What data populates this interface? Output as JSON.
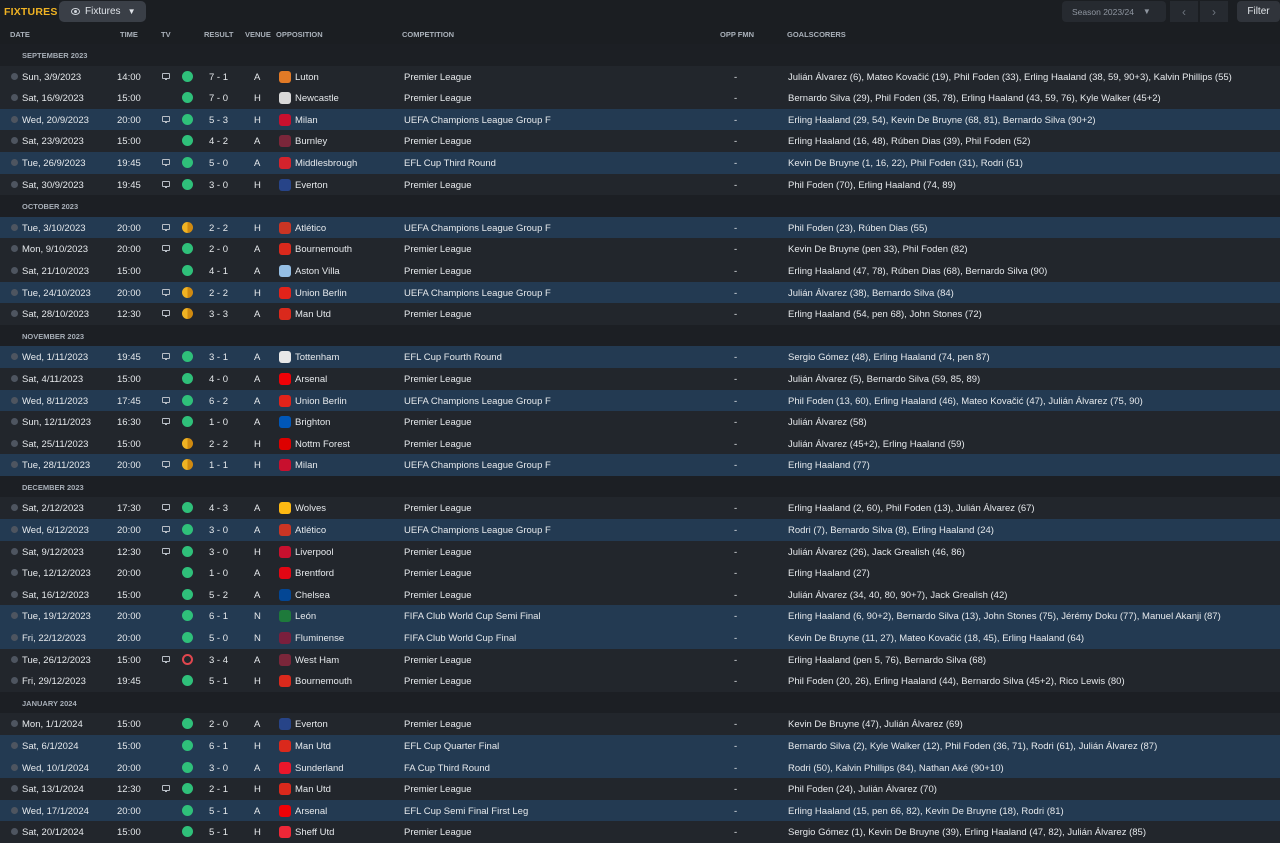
{
  "header": {
    "title": "FIXTURES",
    "view_dropdown": "Fixtures",
    "season": "Season 2023/24",
    "filter": "Filter",
    "prev_icon": "chevron-left-icon",
    "next_icon": "chevron-right-icon"
  },
  "columns": {
    "date": "DATE",
    "time": "TIME",
    "tv": "TV",
    "result": "RESULT",
    "venue": "VENUE",
    "opposition": "OPPOSITION",
    "competition": "COMPETITION",
    "opp_fmn": "OPP FMN",
    "goalscorers": "GOALSCORERS"
  },
  "colors": {
    "win": "#2fc07a",
    "draw": "#f0b323",
    "loss": "#e0464e",
    "accent": "#f0b323",
    "highlight_row": "#233a52"
  },
  "fixtures": [
    {
      "type": "month",
      "label": "SEPTEMBER 2023"
    },
    {
      "date": "Sun, 3/9/2023",
      "time": "14:00",
      "tv": true,
      "outcome": "win",
      "result": "7 - 1",
      "venue": "A",
      "opposition": "Luton",
      "competition": "Premier League",
      "opp_fmn": "-",
      "scorers": "Julián Álvarez (6), Mateo Kovačić (19), Phil Foden (33), Erling Haaland (38, 59, 90+3), Kalvin Phillips (55)",
      "hl": false,
      "crest": "#e27a26"
    },
    {
      "date": "Sat, 16/9/2023",
      "time": "15:00",
      "tv": false,
      "outcome": "win",
      "result": "7 - 0",
      "venue": "H",
      "opposition": "Newcastle",
      "competition": "Premier League",
      "opp_fmn": "-",
      "scorers": "Bernardo Silva (29), Phil Foden (35, 78), Erling Haaland (43, 59, 76), Kyle Walker (45+2)",
      "hl": false,
      "crest": "#d9d9d9"
    },
    {
      "date": "Wed, 20/9/2023",
      "time": "20:00",
      "tv": true,
      "outcome": "win",
      "result": "5 - 3",
      "venue": "H",
      "opposition": "Milan",
      "competition": "UEFA Champions League Group F",
      "opp_fmn": "-",
      "scorers": "Erling Haaland (29, 54), Kevin De Bruyne (68, 81), Bernardo Silva (90+2)",
      "hl": true,
      "crest": "#c8102e"
    },
    {
      "date": "Sat, 23/9/2023",
      "time": "15:00",
      "tv": false,
      "outcome": "win",
      "result": "4 - 2",
      "venue": "A",
      "opposition": "Burnley",
      "competition": "Premier League",
      "opp_fmn": "-",
      "scorers": "Erling Haaland (16, 48), Rúben Dias (39), Phil Foden (52)",
      "hl": false,
      "crest": "#7a263a"
    },
    {
      "date": "Tue, 26/9/2023",
      "time": "19:45",
      "tv": true,
      "outcome": "win",
      "result": "5 - 0",
      "venue": "A",
      "opposition": "Middlesbrough",
      "competition": "EFL Cup Third Round",
      "opp_fmn": "-",
      "scorers": "Kevin De Bruyne (1, 16, 22), Phil Foden (31), Rodri (51)",
      "hl": true,
      "crest": "#d4232c"
    },
    {
      "date": "Sat, 30/9/2023",
      "time": "19:45",
      "tv": true,
      "outcome": "win",
      "result": "3 - 0",
      "venue": "H",
      "opposition": "Everton",
      "competition": "Premier League",
      "opp_fmn": "-",
      "scorers": "Phil Foden (70), Erling Haaland (74, 89)",
      "hl": false,
      "crest": "#274488"
    },
    {
      "type": "month",
      "label": "OCTOBER 2023"
    },
    {
      "date": "Tue, 3/10/2023",
      "time": "20:00",
      "tv": true,
      "outcome": "draw",
      "result": "2 - 2",
      "venue": "H",
      "opposition": "Atlético",
      "competition": "UEFA Champions League Group F",
      "opp_fmn": "-",
      "scorers": "Phil Foden (23), Rúben Dias (55)",
      "hl": true,
      "crest": "#cb3524"
    },
    {
      "date": "Mon, 9/10/2023",
      "time": "20:00",
      "tv": true,
      "outcome": "win",
      "result": "2 - 0",
      "venue": "A",
      "opposition": "Bournemouth",
      "competition": "Premier League",
      "opp_fmn": "-",
      "scorers": "Kevin De Bruyne (pen 33), Phil Foden (82)",
      "hl": false,
      "crest": "#da291c"
    },
    {
      "date": "Sat, 21/10/2023",
      "time": "15:00",
      "tv": false,
      "outcome": "win",
      "result": "4 - 1",
      "venue": "A",
      "opposition": "Aston Villa",
      "competition": "Premier League",
      "opp_fmn": "-",
      "scorers": "Erling Haaland (47, 78), Rúben Dias (68), Bernardo Silva (90)",
      "hl": false,
      "crest": "#95bfe5"
    },
    {
      "date": "Tue, 24/10/2023",
      "time": "20:00",
      "tv": true,
      "outcome": "draw",
      "result": "2 - 2",
      "venue": "H",
      "opposition": "Union Berlin",
      "competition": "UEFA Champions League Group F",
      "opp_fmn": "-",
      "scorers": "Julián Álvarez (38), Bernardo Silva (84)",
      "hl": true,
      "crest": "#e2231a"
    },
    {
      "date": "Sat, 28/10/2023",
      "time": "12:30",
      "tv": true,
      "outcome": "draw",
      "result": "3 - 3",
      "venue": "A",
      "opposition": "Man Utd",
      "competition": "Premier League",
      "opp_fmn": "-",
      "scorers": "Erling Haaland (54, pen 68), John Stones (72)",
      "hl": false,
      "crest": "#da291c"
    },
    {
      "type": "month",
      "label": "NOVEMBER 2023"
    },
    {
      "date": "Wed, 1/11/2023",
      "time": "19:45",
      "tv": true,
      "outcome": "win",
      "result": "3 - 1",
      "venue": "A",
      "opposition": "Tottenham",
      "competition": "EFL Cup Fourth Round",
      "opp_fmn": "-",
      "scorers": "Sergio Gómez (48), Erling Haaland (74, pen 87)",
      "hl": true,
      "crest": "#e8e8e8"
    },
    {
      "date": "Sat, 4/11/2023",
      "time": "15:00",
      "tv": false,
      "outcome": "win",
      "result": "4 - 0",
      "venue": "A",
      "opposition": "Arsenal",
      "competition": "Premier League",
      "opp_fmn": "-",
      "scorers": "Julián Álvarez (5), Bernardo Silva (59, 85, 89)",
      "hl": false,
      "crest": "#ef0107"
    },
    {
      "date": "Wed, 8/11/2023",
      "time": "17:45",
      "tv": true,
      "outcome": "win",
      "result": "6 - 2",
      "venue": "A",
      "opposition": "Union Berlin",
      "competition": "UEFA Champions League Group F",
      "opp_fmn": "-",
      "scorers": "Phil Foden (13, 60), Erling Haaland (46), Mateo Kovačić (47), Julián Álvarez (75, 90)",
      "hl": true,
      "crest": "#e2231a"
    },
    {
      "date": "Sun, 12/11/2023",
      "time": "16:30",
      "tv": true,
      "outcome": "win",
      "result": "1 - 0",
      "venue": "A",
      "opposition": "Brighton",
      "competition": "Premier League",
      "opp_fmn": "-",
      "scorers": "Julián Álvarez (58)",
      "hl": false,
      "crest": "#0057b8"
    },
    {
      "date": "Sat, 25/11/2023",
      "time": "15:00",
      "tv": false,
      "outcome": "draw",
      "result": "2 - 2",
      "venue": "H",
      "opposition": "Nottm Forest",
      "competition": "Premier League",
      "opp_fmn": "-",
      "scorers": "Julián Álvarez (45+2), Erling Haaland (59)",
      "hl": false,
      "crest": "#dd0000"
    },
    {
      "date": "Tue, 28/11/2023",
      "time": "20:00",
      "tv": true,
      "outcome": "draw",
      "result": "1 - 1",
      "venue": "H",
      "opposition": "Milan",
      "competition": "UEFA Champions League Group F",
      "opp_fmn": "-",
      "scorers": "Erling Haaland (77)",
      "hl": true,
      "crest": "#c8102e"
    },
    {
      "type": "month",
      "label": "DECEMBER 2023"
    },
    {
      "date": "Sat, 2/12/2023",
      "time": "17:30",
      "tv": true,
      "outcome": "win",
      "result": "4 - 3",
      "venue": "A",
      "opposition": "Wolves",
      "competition": "Premier League",
      "opp_fmn": "-",
      "scorers": "Erling Haaland (2, 60), Phil Foden (13), Julián Álvarez (67)",
      "hl": false,
      "crest": "#fdb913"
    },
    {
      "date": "Wed, 6/12/2023",
      "time": "20:00",
      "tv": true,
      "outcome": "win",
      "result": "3 - 0",
      "venue": "A",
      "opposition": "Atlético",
      "competition": "UEFA Champions League Group F",
      "opp_fmn": "-",
      "scorers": "Rodri (7), Bernardo Silva (8), Erling Haaland (24)",
      "hl": true,
      "crest": "#cb3524"
    },
    {
      "date": "Sat, 9/12/2023",
      "time": "12:30",
      "tv": true,
      "outcome": "win",
      "result": "3 - 0",
      "venue": "H",
      "opposition": "Liverpool",
      "competition": "Premier League",
      "opp_fmn": "-",
      "scorers": "Julián Álvarez (26), Jack Grealish (46, 86)",
      "hl": false,
      "crest": "#c8102e"
    },
    {
      "date": "Tue, 12/12/2023",
      "time": "20:00",
      "tv": false,
      "outcome": "win",
      "result": "1 - 0",
      "venue": "A",
      "opposition": "Brentford",
      "competition": "Premier League",
      "opp_fmn": "-",
      "scorers": "Erling Haaland (27)",
      "hl": false,
      "crest": "#e30613"
    },
    {
      "date": "Sat, 16/12/2023",
      "time": "15:00",
      "tv": false,
      "outcome": "win",
      "result": "5 - 2",
      "venue": "A",
      "opposition": "Chelsea",
      "competition": "Premier League",
      "opp_fmn": "-",
      "scorers": "Julián Álvarez (34, 40, 80, 90+7), Jack Grealish (42)",
      "hl": false,
      "crest": "#034694"
    },
    {
      "date": "Tue, 19/12/2023",
      "time": "20:00",
      "tv": false,
      "outcome": "win",
      "result": "6 - 1",
      "venue": "N",
      "opposition": "León",
      "competition": "FIFA Club World Cup Semi Final",
      "opp_fmn": "-",
      "scorers": "Erling Haaland (6, 90+2), Bernardo Silva (13), John Stones (75), Jérémy Doku (77), Manuel Akanji (87)",
      "hl": true,
      "crest": "#1e7a3b"
    },
    {
      "date": "Fri, 22/12/2023",
      "time": "20:00",
      "tv": false,
      "outcome": "win",
      "result": "5 - 0",
      "venue": "N",
      "opposition": "Fluminense",
      "competition": "FIFA Club World Cup Final",
      "opp_fmn": "-",
      "scorers": "Kevin De Bruyne (11, 27), Mateo Kovačić (18, 45), Erling Haaland (64)",
      "hl": true,
      "crest": "#7a1f3d"
    },
    {
      "date": "Tue, 26/12/2023",
      "time": "15:00",
      "tv": true,
      "outcome": "loss",
      "result": "3 - 4",
      "venue": "A",
      "opposition": "West Ham",
      "competition": "Premier League",
      "opp_fmn": "-",
      "scorers": "Erling Haaland (pen 5, 76), Bernardo Silva (68)",
      "hl": false,
      "crest": "#7a263a"
    },
    {
      "date": "Fri, 29/12/2023",
      "time": "19:45",
      "tv": false,
      "outcome": "win",
      "result": "5 - 1",
      "venue": "H",
      "opposition": "Bournemouth",
      "competition": "Premier League",
      "opp_fmn": "-",
      "scorers": "Phil Foden (20, 26), Erling Haaland (44), Bernardo Silva (45+2), Rico Lewis (80)",
      "hl": false,
      "crest": "#da291c"
    },
    {
      "type": "month",
      "label": "JANUARY 2024"
    },
    {
      "date": "Mon, 1/1/2024",
      "time": "15:00",
      "tv": false,
      "outcome": "win",
      "result": "2 - 0",
      "venue": "A",
      "opposition": "Everton",
      "competition": "Premier League",
      "opp_fmn": "-",
      "scorers": "Kevin De Bruyne (47), Julián Álvarez (69)",
      "hl": false,
      "crest": "#274488"
    },
    {
      "date": "Sat, 6/1/2024",
      "time": "15:00",
      "tv": false,
      "outcome": "win",
      "result": "6 - 1",
      "venue": "H",
      "opposition": "Man Utd",
      "competition": "EFL Cup Quarter Final",
      "opp_fmn": "-",
      "scorers": "Bernardo Silva (2), Kyle Walker (12), Phil Foden (36, 71), Rodri (61), Julián Álvarez (87)",
      "hl": true,
      "crest": "#da291c"
    },
    {
      "date": "Wed, 10/1/2024",
      "time": "20:00",
      "tv": false,
      "outcome": "win",
      "result": "3 - 0",
      "venue": "A",
      "opposition": "Sunderland",
      "competition": "FA Cup Third Round",
      "opp_fmn": "-",
      "scorers": "Rodri (50), Kalvin Phillips (84), Nathan Aké (90+10)",
      "hl": true,
      "crest": "#eb172b"
    },
    {
      "date": "Sat, 13/1/2024",
      "time": "12:30",
      "tv": true,
      "outcome": "win",
      "result": "2 - 1",
      "venue": "H",
      "opposition": "Man Utd",
      "competition": "Premier League",
      "opp_fmn": "-",
      "scorers": "Phil Foden (24), Julián Álvarez (70)",
      "hl": false,
      "crest": "#da291c"
    },
    {
      "date": "Wed, 17/1/2024",
      "time": "20:00",
      "tv": false,
      "outcome": "win",
      "result": "5 - 1",
      "venue": "A",
      "opposition": "Arsenal",
      "competition": "EFL Cup Semi Final First Leg",
      "opp_fmn": "-",
      "scorers": "Erling Haaland (15, pen 66, 82), Kevin De Bruyne (18), Rodri (81)",
      "hl": true,
      "crest": "#ef0107"
    },
    {
      "date": "Sat, 20/1/2024",
      "time": "15:00",
      "tv": false,
      "outcome": "win",
      "result": "5 - 1",
      "venue": "H",
      "opposition": "Sheff Utd",
      "competition": "Premier League",
      "opp_fmn": "-",
      "scorers": "Sergio Gómez (1), Kevin De Bruyne (39), Erling Haaland (47, 82), Julián Álvarez (85)",
      "hl": false,
      "crest": "#ee2737"
    }
  ]
}
